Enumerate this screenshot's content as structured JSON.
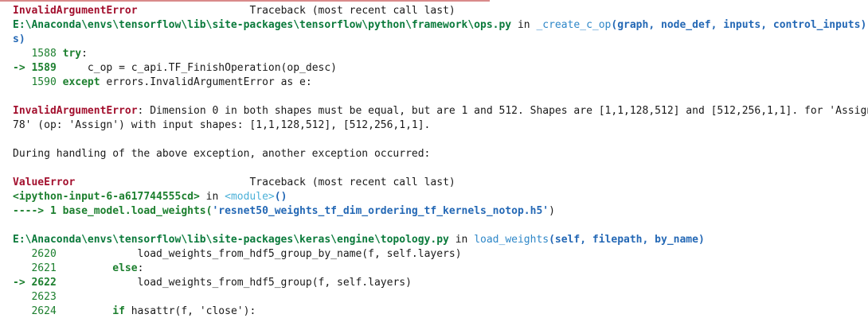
{
  "colors": {
    "error": "#a3102e",
    "path": "#0a7a3b",
    "function": "#2e87c8",
    "keyword": "#1c7f2e",
    "divider": "#d98a8a"
  },
  "tb1": {
    "error_name": "InvalidArgumentError",
    "traceback_header": "Traceback (most recent call last)",
    "file_path": "E:\\Anaconda\\envs\\tensorflow\\lib\\site-packages\\tensorflow\\python\\framework\\ops.py",
    "in_word": " in ",
    "func_name": "_create_c_op",
    "func_args": "(graph, node_def, inputs, control_inputs)",
    "wrap_tail": "s)",
    "lines": [
      {
        "gutter": "   1588 ",
        "kw": "try",
        "rest": ":"
      },
      {
        "gutter": "-> 1589 ",
        "kw": "",
        "rest": "    c_op = c_api.TF_FinishOperation(op_desc)"
      },
      {
        "gutter": "   1590 ",
        "kw": "except",
        "rest": " errors.InvalidArgumentError as e:"
      }
    ]
  },
  "error_message": {
    "name": "InvalidArgumentError",
    "line1": ": Dimension 0 in both shapes must be equal, but are 1 and 512. Shapes are [1,1,128,512] and [512,256,1,1]. for 'Assign_",
    "line2": "78' (op: 'Assign') with input shapes: [1,1,128,512], [512,256,1,1]."
  },
  "during_handling": "During handling of the above exception, another exception occurred:",
  "tb2": {
    "error_name": "ValueError",
    "traceback_header": "Traceback (most recent call last)",
    "cell_ref": "<ipython-input-6-a617744555cd>",
    "in_word": " in ",
    "module": "<module>",
    "module_parens": "()",
    "arrow_line": "----> 1 base_model.load_weights(",
    "arrow_string": "'resnet50_weights_tf_dim_ordering_tf_kernels_notop.h5'",
    "arrow_close": ")"
  },
  "tb3": {
    "file_path": "E:\\Anaconda\\envs\\tensorflow\\lib\\site-packages\\keras\\engine\\topology.py",
    "in_word": " in ",
    "func_name": "load_weights",
    "func_args": "(self, filepath, by_name)",
    "lines": [
      {
        "gutter": "   2620 ",
        "code": "            load_weights_from_hdf5_group_by_name(f, self.layers)"
      },
      {
        "gutter": "   2621 ",
        "code": "        else:"
      },
      {
        "gutter": "-> 2622 ",
        "code": "            load_weights_from_hdf5_group(f, self.layers)"
      },
      {
        "gutter": "   2623 ",
        "code": ""
      },
      {
        "gutter": "   2624 ",
        "code": "        if hasattr(f, 'close'):"
      }
    ]
  }
}
